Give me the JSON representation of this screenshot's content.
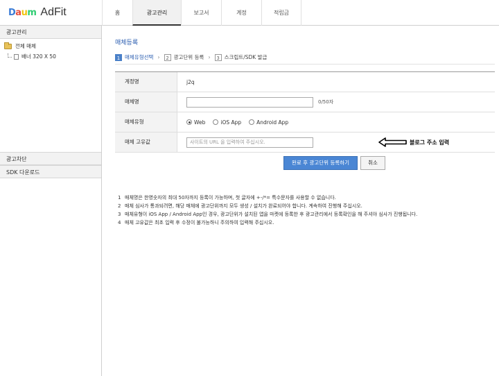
{
  "header": {
    "logo_daum": [
      "D",
      "a",
      "u",
      "m"
    ],
    "logo_adfit": "AdFit",
    "nav": [
      {
        "label": "홈",
        "active": false
      },
      {
        "label": "광고관리",
        "active": true
      },
      {
        "label": "보고서",
        "active": false
      },
      {
        "label": "계정",
        "active": false
      },
      {
        "label": "적립금",
        "active": false
      }
    ]
  },
  "sidebar": {
    "section_ad_manage": "광고관리",
    "tree_root": "전체 매체",
    "tree_child": "배너 320 X 50",
    "section_ad_block": "광고차단",
    "section_sdk": "SDK 다운로드"
  },
  "main": {
    "title": "매체등록",
    "steps": [
      {
        "num": "1",
        "label": "매체유형선택",
        "active": true
      },
      {
        "num": "2",
        "label": "광고단위 등록",
        "active": false
      },
      {
        "num": "3",
        "label": "스크립트/SDK 발급",
        "active": false
      }
    ],
    "form": {
      "account_label": "계정명",
      "account_value": "j2q",
      "media_name_label": "매체명",
      "media_name_value": "",
      "media_name_count": "0/50자",
      "media_type_label": "매체유형",
      "media_type_options": [
        "Web",
        "iOS App",
        "Android App"
      ],
      "media_type_selected": "Web",
      "unique_label": "매체 고유값",
      "unique_placeholder": "사이트의 URL 을 입력하여 주십시오.",
      "annotation": "블로그 주소 입력"
    },
    "buttons": {
      "submit": "완료 후 광고단위 등록하기",
      "cancel": "취소"
    },
    "notes": [
      {
        "num": "1",
        "text": "매체명은 한영숫자의 최대 50자까지 등록이 가능하며, 첫 글자에 +-/*= 특수문자를 사용할 수 없습니다."
      },
      {
        "num": "2",
        "text": "매체 심사가 통과되려면, 해당 매체에 광고단위까지 모두 생성 / 설치가 완료되어야 합니다. 계속하여 진행해 주십시오."
      },
      {
        "num": "3",
        "text": "매체유형이 iOS App / Android App인 경우, 광고단위가 설치된 앱을 마켓에 등록한 후 광고관리에서 등록확인을 해 주셔야 심사가 진행됩니다."
      },
      {
        "num": "4",
        "text": "매체 고유값은 최초 입력 후 수정이 불가능하니 주의하여 입력해 주십시오."
      }
    ]
  }
}
